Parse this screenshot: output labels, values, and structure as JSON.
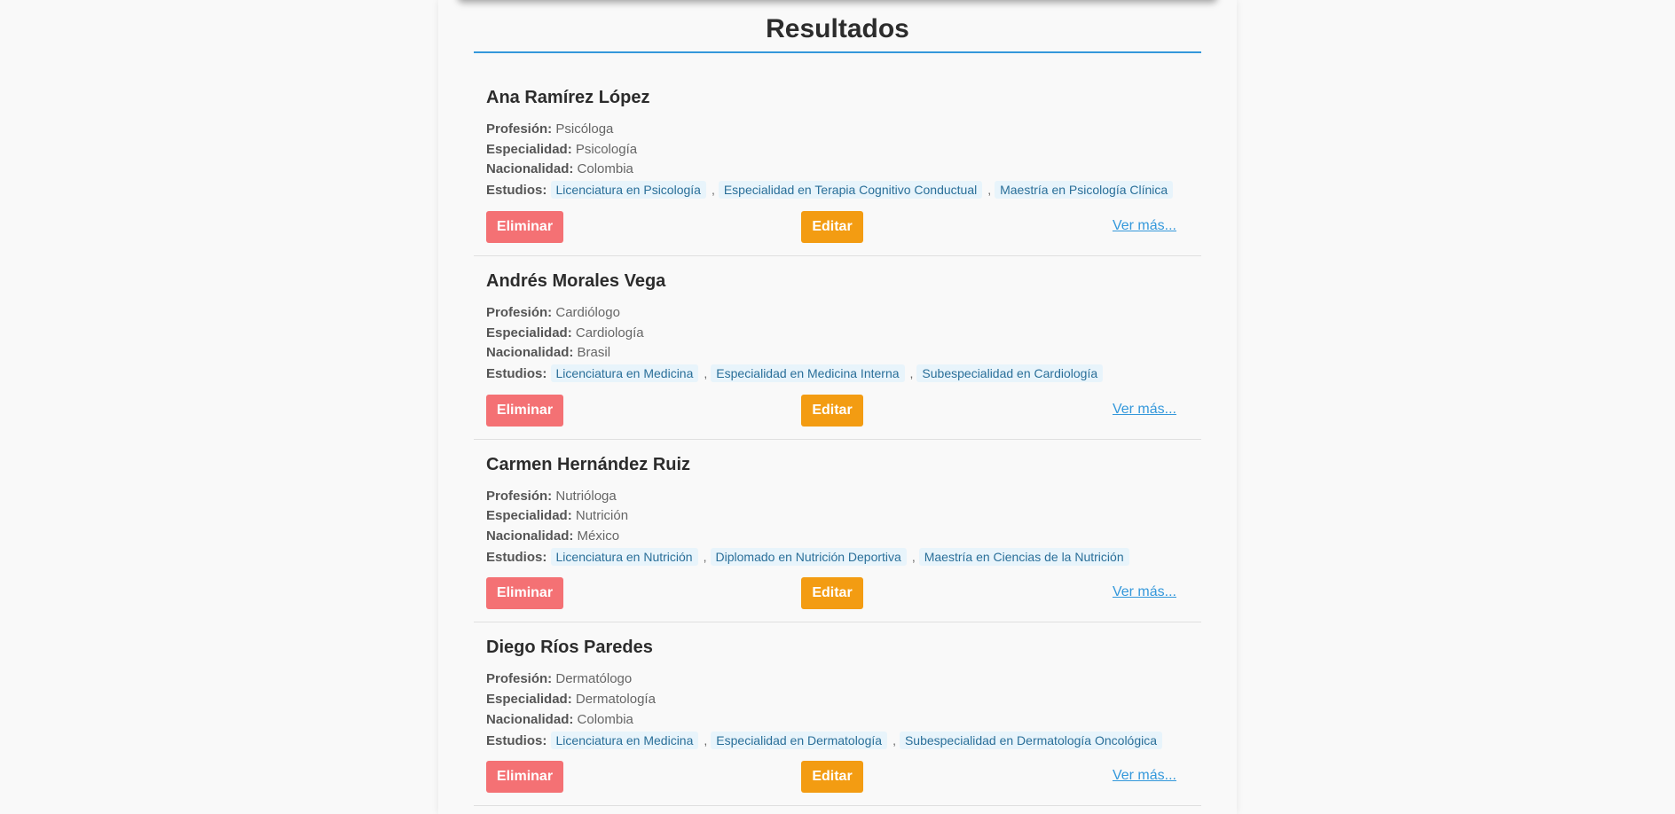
{
  "results": {
    "title": "Resultados",
    "labels": {
      "profession": "Profesión:",
      "specialty": "Especialidad:",
      "nationality": "Nacionalidad:",
      "studies": "Estudios:"
    },
    "buttons": {
      "delete": "Eliminar",
      "edit": "Editar",
      "more": "Ver más..."
    },
    "colors": {
      "accent": "#3498db",
      "delete": "#f47174",
      "edit": "#f39c12",
      "tag_bg": "#e8f4fb"
    },
    "people": [
      {
        "name": "Ana Ramírez López",
        "profession": "Psicóloga",
        "specialty": "Psicología",
        "nationality": "Colombia",
        "studies": [
          "Licenciatura en Psicología",
          "Especialidad en Terapia Cognitivo Conductual",
          "Maestría en Psicología Clínica"
        ]
      },
      {
        "name": "Andrés Morales Vega",
        "profession": "Cardiólogo",
        "specialty": "Cardiología",
        "nationality": "Brasil",
        "studies": [
          "Licenciatura en Medicina",
          "Especialidad en Medicina Interna",
          "Subespecialidad en Cardiología"
        ]
      },
      {
        "name": "Carmen Hernández Ruiz",
        "profession": "Nutrióloga",
        "specialty": "Nutrición",
        "nationality": "México",
        "studies": [
          "Licenciatura en Nutrición",
          "Diplomado en Nutrición Deportiva",
          "Maestría en Ciencias de la Nutrición"
        ]
      },
      {
        "name": "Diego Ríos Paredes",
        "profession": "Dermatólogo",
        "specialty": "Dermatología",
        "nationality": "Colombia",
        "studies": [
          "Licenciatura en Medicina",
          "Especialidad en Dermatología",
          "Subespecialidad en Dermatología Oncológica"
        ]
      }
    ]
  }
}
